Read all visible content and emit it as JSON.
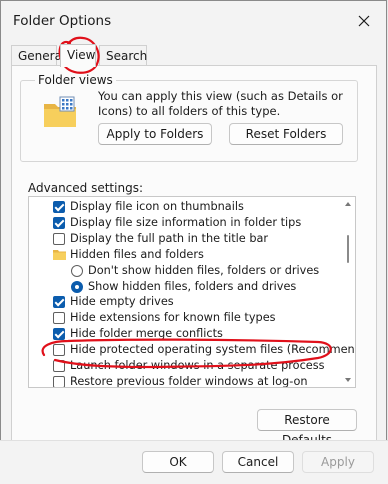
{
  "window": {
    "title": "Folder Options",
    "close_icon": "close-icon"
  },
  "tabs": [
    {
      "label": "General",
      "active": false
    },
    {
      "label": "View",
      "active": true
    },
    {
      "label": "Search",
      "active": false
    }
  ],
  "folder_views": {
    "legend": "Folder views",
    "description": "You can apply this view (such as Details or Icons) to all folders of this type.",
    "apply_label": "Apply to Folders",
    "reset_label": "Reset Folders"
  },
  "advanced": {
    "label": "Advanced settings:",
    "items": [
      {
        "kind": "checkbox",
        "checked": true,
        "indent": 0,
        "label": "Display file icon on thumbnails"
      },
      {
        "kind": "checkbox",
        "checked": true,
        "indent": 0,
        "label": "Display file size information in folder tips"
      },
      {
        "kind": "checkbox",
        "checked": false,
        "indent": 0,
        "label": "Display the full path in the title bar"
      },
      {
        "kind": "folder",
        "checked": false,
        "indent": 0,
        "label": "Hidden files and folders"
      },
      {
        "kind": "radio",
        "checked": false,
        "indent": 1,
        "label": "Don't show hidden files, folders or drives"
      },
      {
        "kind": "radio",
        "checked": true,
        "indent": 1,
        "label": "Show hidden files, folders and drives"
      },
      {
        "kind": "checkbox",
        "checked": true,
        "indent": 0,
        "label": "Hide empty drives"
      },
      {
        "kind": "checkbox",
        "checked": false,
        "indent": 0,
        "label": "Hide extensions for known file types"
      },
      {
        "kind": "checkbox",
        "checked": true,
        "indent": 0,
        "label": "Hide folder merge conflicts"
      },
      {
        "kind": "checkbox",
        "checked": false,
        "indent": 0,
        "label": "Hide protected operating system files (Recommended)"
      },
      {
        "kind": "checkbox",
        "checked": false,
        "indent": 0,
        "label": "Launch folder windows in a separate process"
      },
      {
        "kind": "checkbox",
        "checked": false,
        "indent": 0,
        "label": "Restore previous folder windows at log-on"
      }
    ],
    "restore_label": "Restore Defaults"
  },
  "footer": {
    "ok_label": "OK",
    "cancel_label": "Cancel",
    "apply_label": "Apply"
  },
  "colors": {
    "accent": "#0b5cad",
    "annotation": "#e0101a"
  }
}
